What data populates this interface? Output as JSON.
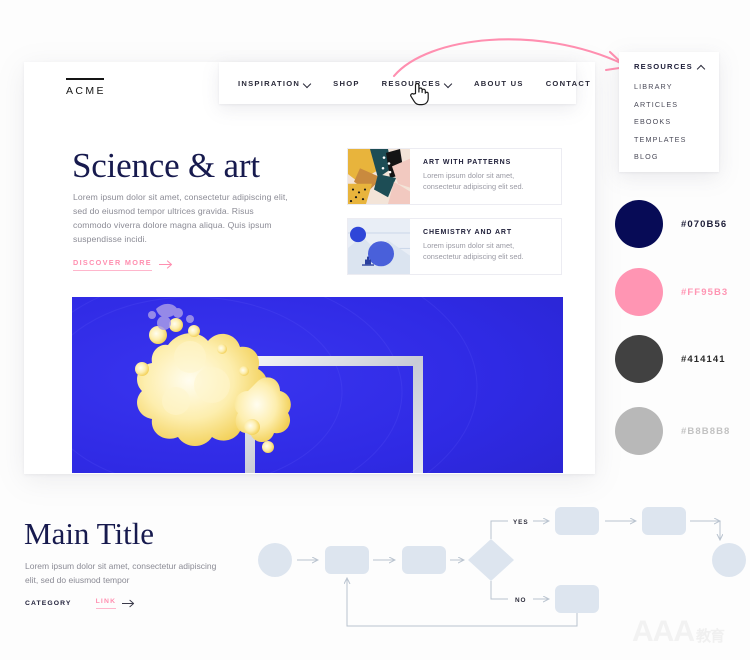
{
  "brand": {
    "name": "ACME"
  },
  "nav": {
    "items": [
      {
        "label": "INSPIRATION",
        "caret": "chevron-down-icon"
      },
      {
        "label": "SHOP",
        "caret": ""
      },
      {
        "label": "RESOURCES",
        "caret": "chevron-down-icon"
      },
      {
        "label": "ABOUT US",
        "caret": ""
      },
      {
        "label": "CONTACT",
        "caret": ""
      }
    ]
  },
  "dropdown": {
    "title": "RESOURCES",
    "caret": "chevron-up-icon",
    "items": [
      "LIBRARY",
      "ARTICLES",
      "EBOOKS",
      "TEMPLATES",
      "BLOG"
    ]
  },
  "hero": {
    "title": "Science & art",
    "body": "Lorem ipsum dolor sit amet, consectetur adipiscing elit, sed do eiusmod tempor ultrices gravida. Risus commodo viverra dolore magna aliqua. Quis ipsum suspendisse incidi.",
    "cta": "DISCOVER MORE",
    "cta_icon": "arrow-right-icon"
  },
  "cards": [
    {
      "title": "ART WITH PATTERNS",
      "desc": "Lorem ipsum dolor sit amet, consectetur adipiscing elit sed."
    },
    {
      "title": "CHEMISTRY AND ART",
      "desc": "Lorem ipsum dolor sit amet, consectetur adipiscing elit sed."
    }
  ],
  "bottom": {
    "title": "Main Title",
    "body": "Lorem ipsum dolor sit amet, consectetur adipiscing elit, sed do eiusmod tempor",
    "category": "CATEGORY",
    "link": "LINK",
    "link_icon": "arrow-right-icon"
  },
  "swatches": [
    {
      "hex": "#070B56",
      "label": "#070B56",
      "label_color": "#20203a"
    },
    {
      "hex": "#FF95B3",
      "label": "#FF95B3",
      "label_color": "#FF95B3"
    },
    {
      "hex": "#414141",
      "label": "#414141",
      "label_color": "#2a2a2a"
    },
    {
      "hex": "#B8B8B8",
      "label": "#B8B8B8",
      "label_color": "#c2c2c2"
    }
  ],
  "flowchart": {
    "labels": {
      "yes": "YES",
      "no": "NO"
    },
    "node_fill": "#dde5ef",
    "connector_color": "#b9c3cf"
  },
  "watermark": {
    "text": "AAA",
    "cjk": "教育"
  }
}
